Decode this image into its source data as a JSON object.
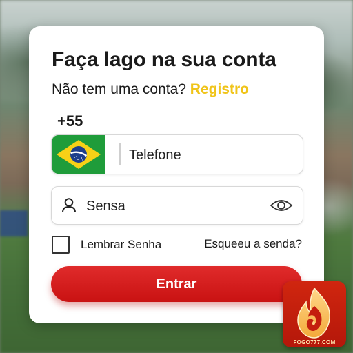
{
  "login": {
    "title": "Faça lago na sua conta",
    "subtitle_text": "Não tem uma conta?",
    "register_link": "Registro",
    "country_code": "+55",
    "country_flag": "brazil-flag-icon",
    "phone_placeholder": "Telefone",
    "password_placeholder": "Sensa",
    "remember_label": "Lembrar Senha",
    "forgot_link": "Esqueeu a senda?",
    "submit_label": "Entrar"
  },
  "brand": {
    "logo_text": "FOGO777.COM"
  },
  "colors": {
    "accent_link": "#f0c419",
    "primary_button": "#d41d1d",
    "card_bg": "#ffffff",
    "logo_bg": "#c41e0e"
  }
}
